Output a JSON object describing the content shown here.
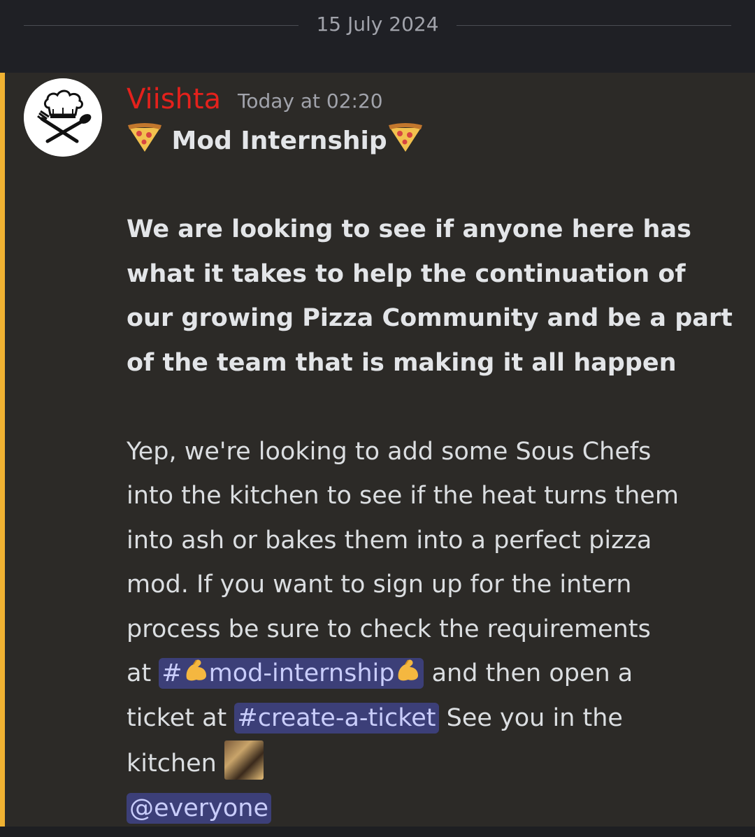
{
  "divider": {
    "date": "15 July 2024"
  },
  "message": {
    "author": "Viishta",
    "timestamp": "Today at 02:20",
    "title": "Mod Internship",
    "bold_lines": [
      "We are looking to see if anyone here has",
      "what it takes to help the continuation of",
      "our growing Pizza Community and be a part",
      "of the team that is making it all happen"
    ],
    "body_lines": [
      "Yep, we're looking to add some Sous Chefs",
      "into the kitchen to see if the heat turns them",
      "into ash or bakes them into a perfect pizza",
      "mod. If you want to sign up for the intern",
      "process be sure to check the requirements"
    ],
    "line_at_prefix": "at ",
    "channel1_hash": "#",
    "channel1_name": "mod-internship",
    "line_at_suffix": " and then open a",
    "line_ticket_prefix": "ticket at ",
    "channel2": "#create-a-ticket",
    "line_ticket_suffix": "  See you in the",
    "kitchen_text": "kitchen ",
    "mention_everyone": "@everyone"
  },
  "colors": {
    "author": "#e4211c",
    "highlight_bar": "#f0b232",
    "mention_bg": "#3c3f78",
    "mention_text": "#c9cdfb"
  },
  "icons": {
    "avatar": "chef-hat-fork-spoon-icon",
    "title_emoji": "pizza-icon",
    "channel_emoji": "flexed-biceps-icon",
    "kitchen_emoji": "kitchen-fire-image"
  }
}
